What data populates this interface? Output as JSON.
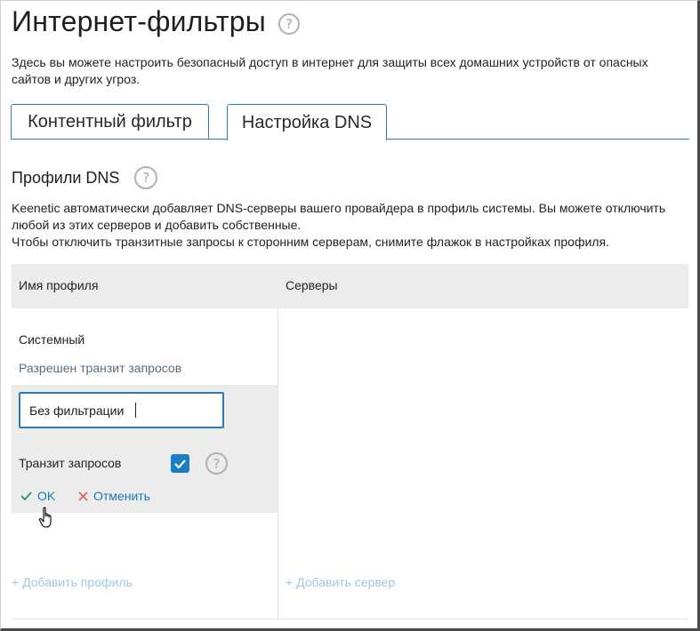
{
  "page": {
    "title": "Интернет-фильтры",
    "description": "Здесь вы можете настроить безопасный доступ в интернет для защиты всех домашних устройств от опасных сайтов и других угроз."
  },
  "tabs": [
    {
      "label": "Контентный фильтр",
      "active": false
    },
    {
      "label": "Настройка DNS",
      "active": true
    }
  ],
  "section": {
    "title": "Профили DNS",
    "info_line1": "Keenetic автоматически добавляет DNS-серверы вашего провайдера в профиль системы. Вы можете отключить любой из этих серверов и добавить собственные.",
    "info_line2": "Чтобы отключить транзитные запросы к сторонним серверам, снимите флажок в настройках профиля."
  },
  "table": {
    "col_name": "Имя профиля",
    "col_servers": "Серверы"
  },
  "profile": {
    "name": "Системный",
    "status": "Разрешен транзит запросов"
  },
  "editor": {
    "name_value": "Без фильтрации",
    "transit_label": "Транзит запросов",
    "transit_checked": true,
    "ok_label": "OK",
    "cancel_label": "Отменить"
  },
  "actions": {
    "add_profile": "+ Добавить профиль",
    "add_server": "+ Добавить сервер"
  },
  "icons": {
    "help": "help-circle-icon",
    "check": "check-icon",
    "cancel": "close-icon",
    "cursor": "hand-pointer-icon"
  },
  "colors": {
    "accent": "#2b7cb5",
    "checkbox": "#1a7fc2",
    "ok_check": "#2e9b6d",
    "cancel_x": "#e05a5a",
    "link_faded": "#9fc6e3",
    "panel_bg": "#ececec"
  }
}
